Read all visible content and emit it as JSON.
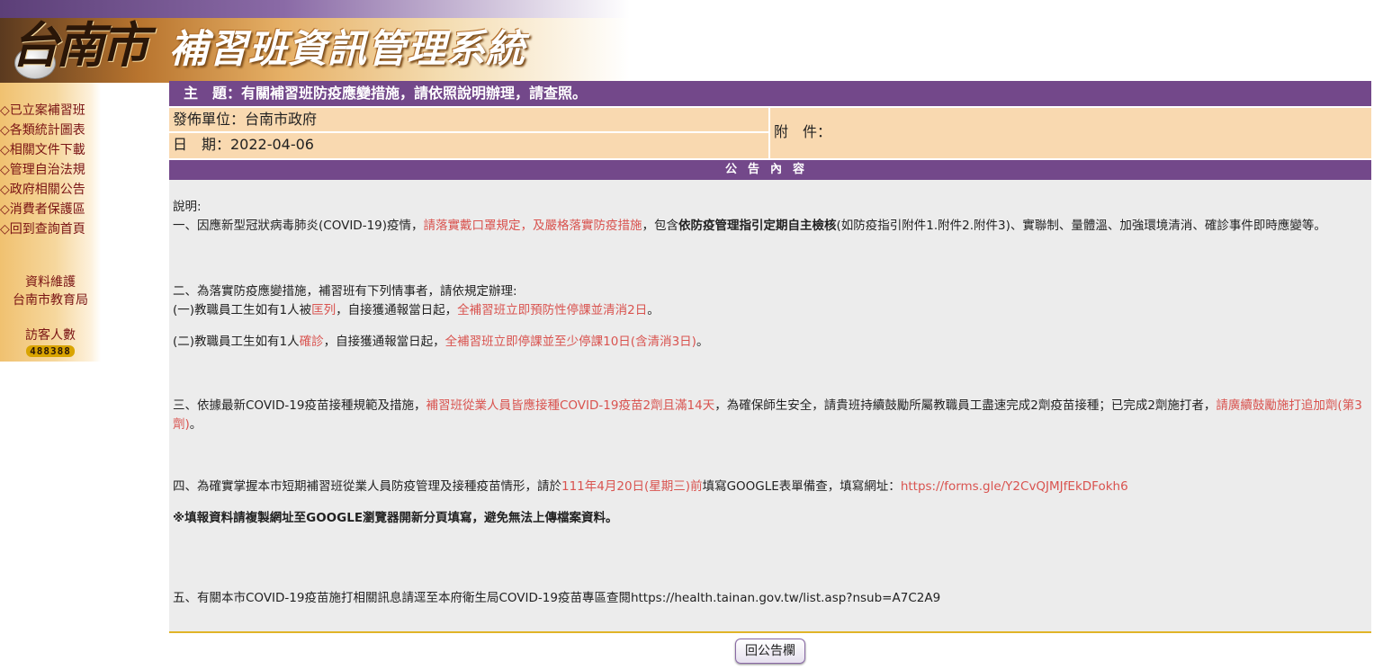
{
  "header": {
    "city": "台南市",
    "system_title": "補習班資訊管理系統"
  },
  "sidebar": {
    "nav": [
      "◇已立案補習班",
      "◇各類統計圖表",
      "◇相關文件下載",
      "◇管理自治法規",
      "◇政府相關公告",
      "◇消費者保護區",
      "◇回到查詢首頁"
    ],
    "maintenance_label": "資料維護",
    "maintenance_org": "台南市教育局",
    "visitor_label": "訪客人數",
    "visitor_count": "488388"
  },
  "announcement": {
    "subject": "主　題：有關補習班防疫應變措施，請依照說明辦理，請查照。",
    "publisher": "發佈單位：台南市政府",
    "date": "日　期：2022-04-06",
    "attachment_label": "附　件：",
    "content_header": "公告內容",
    "p0": "說明:",
    "p1_a": "一、因應新型冠狀病毒肺炎(COVID-19)疫情，",
    "p1_b": "請落實戴口罩規定，及嚴格落實防疫措施",
    "p1_c": "，包含",
    "p1_d": "依防疫管理指引定期自主檢核",
    "p1_e": "(如防疫指引附件1.附件2.附件3)、實聯制、量體溫、加強環境清消、確診事件即時應變等。",
    "p2_title": "二、為落實防疫應變措施，補習班有下列情事者，請依規定辦理:",
    "p2_1a": "(一)教職員工生如有1人被",
    "p2_1b": "匡列",
    "p2_1c": "，自接獲通報當日起，",
    "p2_1d": "全補習班立即預防性停課並清消2日",
    "p2_1e": "。",
    "p2_2a": "(二)教職員工生如有1人",
    "p2_2b": "確診",
    "p2_2c": "，自接獲通報當日起，",
    "p2_2d": "全補習班立即停課並至少停課10日(含清消3日)",
    "p2_2e": "。",
    "p3_a": "三、依據最新COVID-19疫苗接種規範及措施，",
    "p3_b": "補習班從業人員皆應接種COVID-19疫苗2劑且滿14天",
    "p3_c": "，為確保師生安全，請貴班持續鼓勵所屬教職員工盡速完成2劑疫苗接種；已完成2劑施打者，",
    "p3_d": "請廣續鼓勵施打追加劑(第3劑)",
    "p3_e": "。",
    "p4_a": "四、為確實掌握本市短期補習班從業人員防疫管理及接種疫苗情形，請於",
    "p4_b": "111年4月20日(星期三)前",
    "p4_c": "填寫GOOGLE表單備查，填寫網址：",
    "p4_url": "https://forms.gle/Y2CvQJMJfEkDFokh6",
    "p4_note": "※填報資料請複製網址至GOOGLE瀏覽器開新分頁填寫，避免無法上傳檔案資料。",
    "p5": "五、有關本市COVID-19疫苗施打相關訊息請逕至本府衛生局COVID-19疫苗專區查閱https://health.tainan.gov.tw/list.asp?nsub=A7C2A9"
  },
  "back_button": "回公告欄"
}
